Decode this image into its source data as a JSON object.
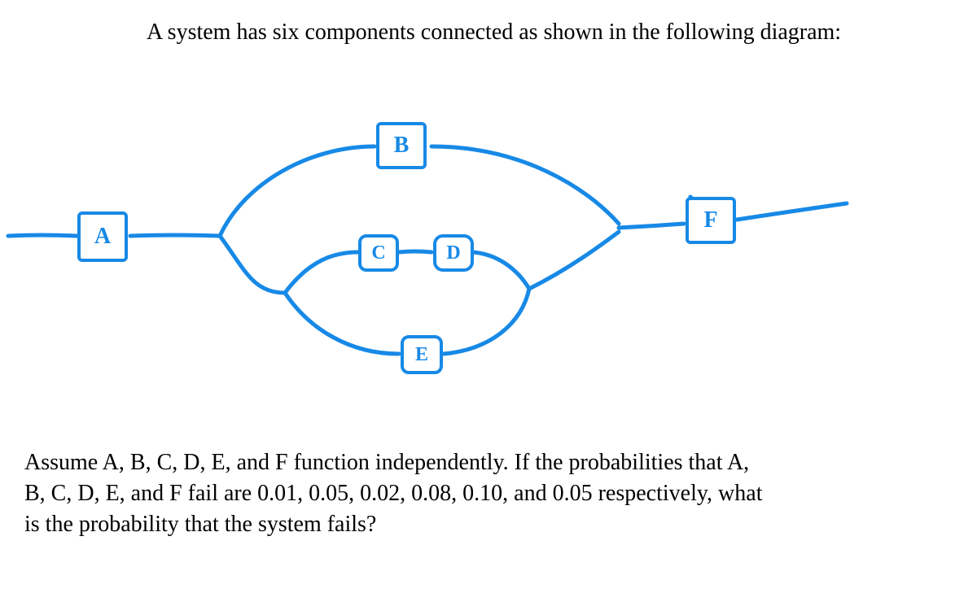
{
  "text": {
    "intro": "A system has six components connected as shown in the following diagram:",
    "question_l1": "Assume A, B, C, D, E, and F function independently.  If the probabilities that A,",
    "question_l2": "B, C, D, E, and F fail are 0.01, 0.05, 0.02, 0.08, 0.10, and 0.05 respectively, what",
    "question_l3": "is the probability that the system fails?"
  },
  "nodes": {
    "A": {
      "label": "A",
      "fail_prob": 0.01
    },
    "B": {
      "label": "B",
      "fail_prob": 0.05
    },
    "C": {
      "label": "C",
      "fail_prob": 0.02
    },
    "D": {
      "label": "D",
      "fail_prob": 0.08
    },
    "E": {
      "label": "E",
      "fail_prob": 0.1
    },
    "F": {
      "label": "F",
      "fail_prob": 0.05
    }
  },
  "diagram": {
    "description": "Reliability block diagram. A is in series with a middle block, which is in series with F. The middle block is three parallel branches: (1) B alone, (2) C in series with D, (3) E alone. Branches (2) and (3) are themselves parallel with each other, and that pair is parallel with B.",
    "series": [
      "A",
      "MIDDLE",
      "F"
    ],
    "middle_parallel": [
      [
        "B"
      ],
      {
        "parallel": [
          [
            "C",
            "D"
          ],
          [
            "E"
          ]
        ]
      }
    ],
    "fail_probs": {
      "A": 0.01,
      "B": 0.05,
      "C": 0.02,
      "D": 0.08,
      "E": 0.1,
      "F": 0.05
    }
  }
}
